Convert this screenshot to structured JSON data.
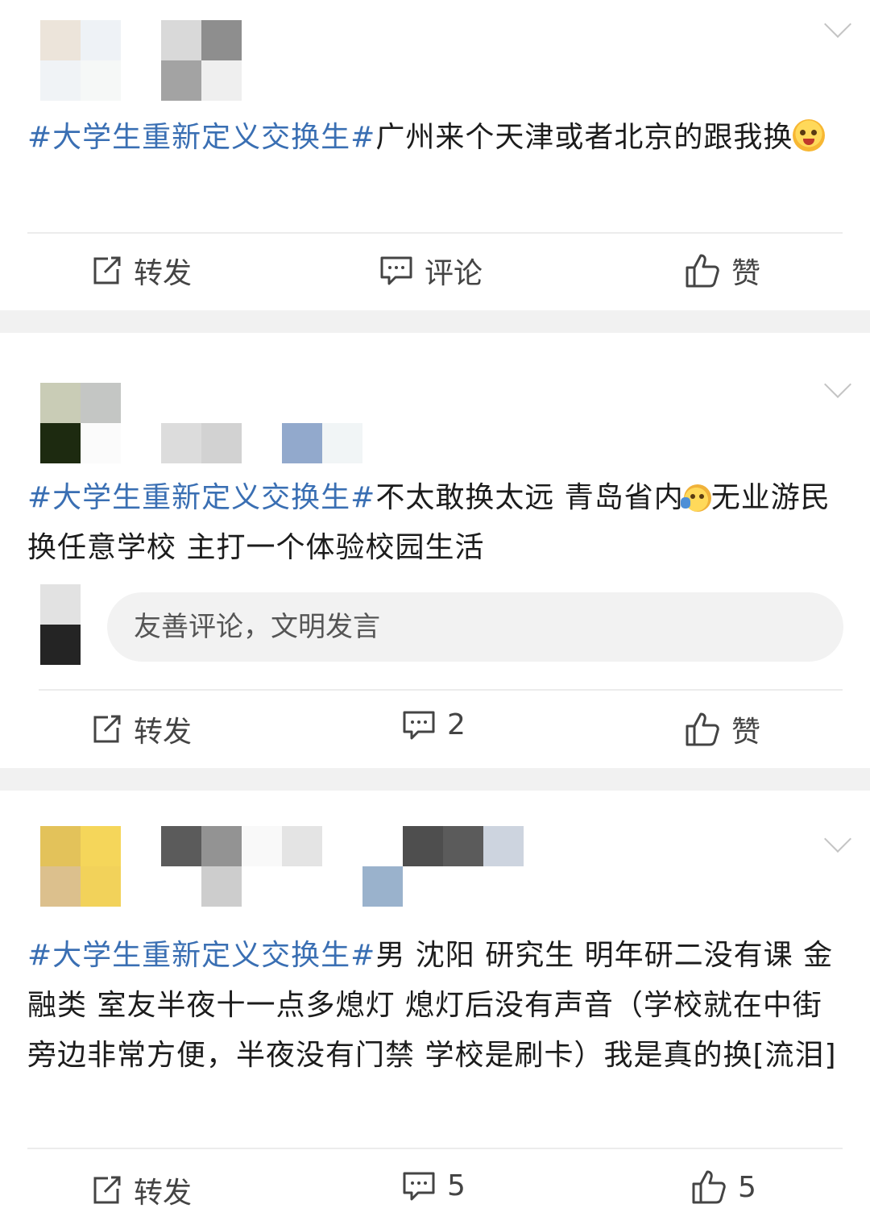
{
  "posts": [
    {
      "text_tag": "#大学生重新定义交换生#",
      "text_body": "广州来个天津或者北京的跟我换",
      "actions": {
        "repost": "转发",
        "comment": "评论",
        "like": "赞"
      }
    },
    {
      "text_tag": "#大学生重新定义交换生#",
      "text_body_a": "不太敢换太远 青岛省内",
      "text_body_b": "无业游民换任意学校  主打一个体验校园生活",
      "comment_placeholder": "友善评论，文明发言",
      "actions": {
        "repost": "转发",
        "comment": "2",
        "like": "赞"
      }
    },
    {
      "text_tag": "#大学生重新定义交换生#",
      "text_body": "男 沈阳 研究生 明年研二没有课 金融类 室友半夜十一点多熄灯 熄灯后没有声音（学校就在中街旁边非常方便，半夜没有门禁 学校是刷卡）我是真的换[流泪]",
      "actions": {
        "repost": "转发",
        "comment": "5",
        "like": "5"
      }
    }
  ],
  "icons": {
    "repost": "repost-icon",
    "comment": "comment-icon",
    "like": "thumbs-up-icon",
    "more": "chevron-down-icon"
  },
  "colors": {
    "hashtag": "#3a6fb3",
    "separator": "#f1f1f1",
    "action_text": "#444444"
  }
}
